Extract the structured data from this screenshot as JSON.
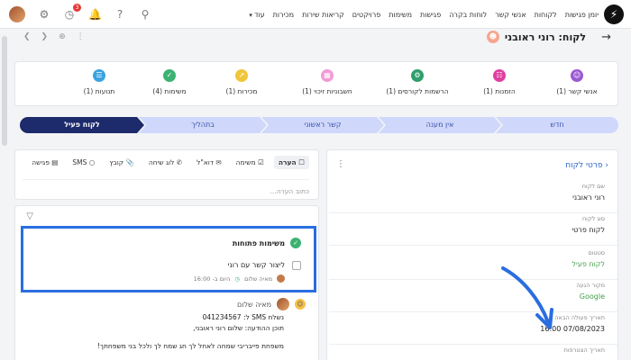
{
  "nav": {
    "items": [
      "יומן פגישות",
      "לקוחות",
      "אנשי קשר",
      "לוחות בקרה",
      "פגישות",
      "משימות",
      "פרויקטים",
      "קריאות שירות",
      "מכירות"
    ],
    "more_label": "עוד",
    "notification_count": "3"
  },
  "header": {
    "title": "לקוח: רוני ראובני"
  },
  "stats": [
    {
      "label": "אנשי קשר (1)",
      "color": "#9b59d0",
      "icon": "contact-icon"
    },
    {
      "label": "הזמנות (1)",
      "color": "#e040a0",
      "icon": "cart-icon"
    },
    {
      "label": "הרשמות לקורסים (1)",
      "color": "#2e9e6a",
      "icon": "gear-icon"
    },
    {
      "label": "חשבוניות זיכוי (1)",
      "color": "#f29bd6",
      "icon": "invoice-icon"
    },
    {
      "label": "מכירות (1)",
      "color": "#f0c53a",
      "icon": "chart-icon"
    },
    {
      "label": "משימות (4)",
      "color": "#3cb371",
      "icon": "check-icon"
    },
    {
      "label": "תנועות (1)",
      "color": "#3aa3e0",
      "icon": "list-icon"
    }
  ],
  "pipeline": {
    "stages": [
      "חדש",
      "אין מענה",
      "קשר ראשוני",
      "בתהליך",
      "לקוח פעיל"
    ],
    "active": "לקוח פעיל"
  },
  "details": {
    "heading": "פרטי לקוח",
    "fields": [
      {
        "label": "שם לקוח",
        "value": "רוני ראובני",
        "green": false
      },
      {
        "label": "סוג לקוח",
        "value": "לקוח פרטי",
        "green": false
      },
      {
        "label": "סטטוס",
        "value": "לקוח פעיל",
        "green": true
      },
      {
        "label": "מקור הגעה",
        "value": "Google",
        "green": true
      },
      {
        "label": "תאריך פעולה הבאה",
        "value": "16:00 07/08/2023",
        "green": false
      },
      {
        "label": "תאריך הצטרפות",
        "value": "",
        "green": false
      }
    ]
  },
  "activity": {
    "tabs": [
      "הערה",
      "משימה",
      "דוא\"ל",
      "לוג שיחה",
      "קובץ",
      "SMS",
      "פגישה"
    ],
    "comment_placeholder": "כתוב הערה..."
  },
  "feed": {
    "tasks_title": "משימות פתוחות",
    "task_title": "ליצור קשר עם רוני",
    "task_owner": "מאיה שלום",
    "task_time": "היום ב- 16:00",
    "msg_author": "מאיה שלום",
    "msg_lines": [
      "נשלח SMS ל: 041234567",
      "תוכן ההודעה: שלום  רוני ראובני,",
      "",
      "משפחת פייבריבי שמחה לאחל לך חג שמח לך ולכל בני משפחתך!"
    ]
  }
}
